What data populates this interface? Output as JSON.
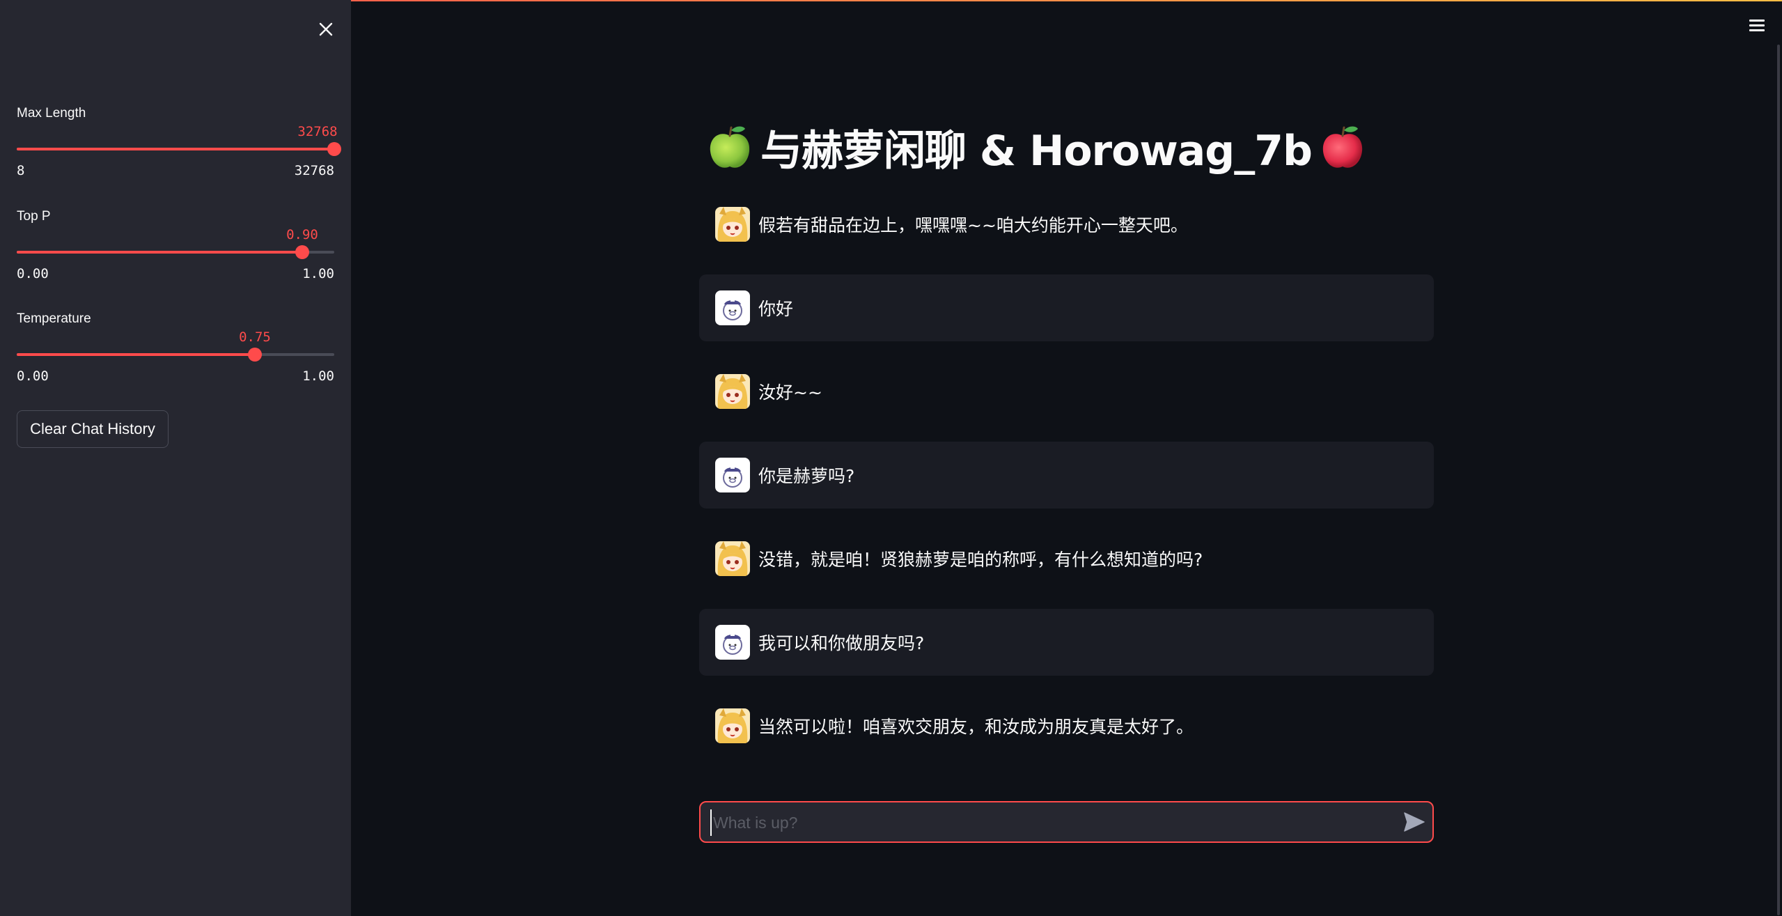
{
  "sidebar": {
    "sliders": [
      {
        "label": "Max Length",
        "value": "32768",
        "min": "8",
        "max": "32768",
        "fraction": 1.0
      },
      {
        "label": "Top P",
        "value": "0.90",
        "min": "0.00",
        "max": "1.00",
        "fraction": 0.9
      },
      {
        "label": "Temperature",
        "value": "0.75",
        "min": "0.00",
        "max": "1.00",
        "fraction": 0.75
      }
    ],
    "clear_button": "Clear Chat History"
  },
  "main": {
    "title": "与赫萝闲聊 & Horowag_7b",
    "messages": [
      {
        "role": "assistant",
        "text": "假若有甜品在边上，嘿嘿嘿~~咱大约能开心一整天吧。"
      },
      {
        "role": "user",
        "text": "你好"
      },
      {
        "role": "assistant",
        "text": "汝好~~"
      },
      {
        "role": "user",
        "text": "你是赫萝吗?"
      },
      {
        "role": "assistant",
        "text": "没错，就是咱！贤狼赫萝是咱的称呼，有什么想知道的吗?"
      },
      {
        "role": "user",
        "text": "我可以和你做朋友吗?"
      },
      {
        "role": "assistant",
        "text": "当然可以啦！咱喜欢交朋友，和汝成为朋友真是太好了。"
      }
    ],
    "input": {
      "placeholder": "What is up?",
      "value": ""
    }
  },
  "icons": {
    "close": "close-icon",
    "menu": "hamburger-menu-icon",
    "send": "send-icon",
    "title_left": "green-apple-icon",
    "title_right": "red-apple-icon"
  },
  "colors": {
    "accent": "#ff4b4b",
    "background": "#0e1117",
    "sidebar": "#262730",
    "user_bubble": "#1a1c24"
  }
}
